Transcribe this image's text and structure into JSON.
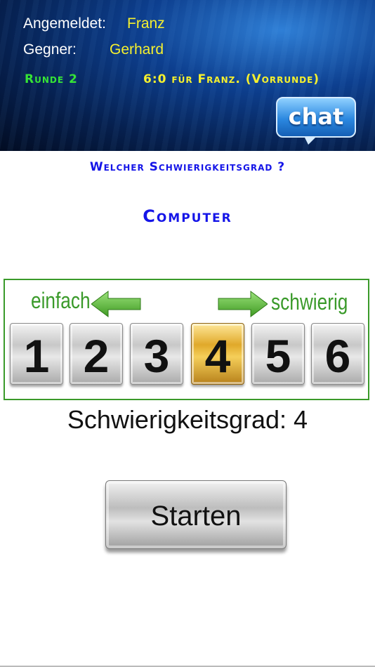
{
  "header": {
    "logged_in_label": "Angemeldet:",
    "logged_in_value": "Franz",
    "opponent_label": "Gegner:",
    "opponent_value": "Gerhard",
    "round": "Runde 2",
    "score": "6:0 für Franz. (Vorrunde)",
    "chat_label": "chat"
  },
  "question": "Welcher Schwierigkeitsgrad ?",
  "mode": "Computer",
  "selector": {
    "easy_label": "einfach",
    "hard_label": "schwierig",
    "levels": [
      "1",
      "2",
      "3",
      "4",
      "5",
      "6"
    ],
    "selected": "4"
  },
  "difficulty_text": "Schwierigkeitsgrad:  4",
  "start_label": "Starten",
  "colors": {
    "header_label": "#ffffff",
    "header_value": "#f5f02e",
    "round": "#36e336",
    "question": "#1515e8",
    "panel_green": "#3a9a2a",
    "selected_gold": "#e0a92a"
  }
}
